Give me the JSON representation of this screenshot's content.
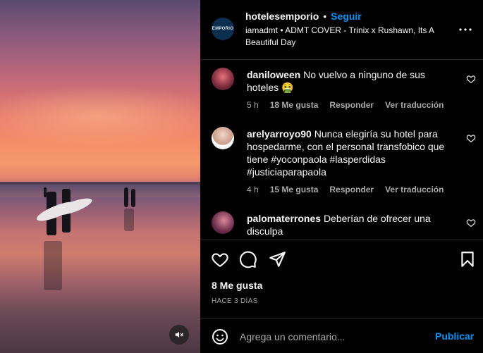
{
  "post": {
    "username": "hotelesemporio",
    "separator": "•",
    "follow_label": "Seguir",
    "audio": "iamadmt • ADMT COVER - Trinix x Rushawn, Its A Beautiful Day",
    "brand_avatar_text": "EMPORIO"
  },
  "comments": [
    {
      "username": "daniloween",
      "text": "No vuelvo a ninguno de sus hoteles 🤮",
      "time": "5 h",
      "likes": "18 Me gusta",
      "reply_label": "Responder",
      "translate_label": "Ver traducción"
    },
    {
      "username": "arelyarroyo90",
      "text": "Nunca elegiría su hotel para hospedarme, con el personal transfobico que tiene #yoconpaola #lasperdidas #justiciaparapaola",
      "time": "4 h",
      "likes": "15 Me gusta",
      "reply_label": "Responder",
      "translate_label": "Ver traducción"
    },
    {
      "username": "palomaterrones",
      "text": "Deberían de ofrecer una disculpa"
    }
  ],
  "actions": {
    "likes": "8 Me gusta",
    "date": "HACE 3 DÍAS"
  },
  "composer": {
    "placeholder": "Agrega un comentario...",
    "publish_label": "Publicar"
  },
  "icons": {
    "like": "heart-icon",
    "comment": "comment-icon",
    "share": "send-icon",
    "save": "bookmark-icon",
    "more": "more-icon",
    "emoji": "emoji-icon",
    "mute": "mute-icon"
  },
  "colors": {
    "accent": "#0095f6",
    "muted_text": "#a8a8a8",
    "divider": "#262626"
  }
}
